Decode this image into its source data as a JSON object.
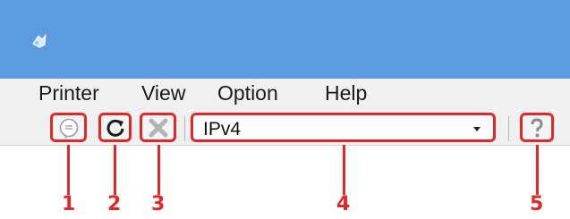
{
  "window": {
    "app_icon": "printer-app-icon",
    "title_color": "#5b9be0"
  },
  "menu": {
    "items": [
      {
        "label": "Printer"
      },
      {
        "label": "View"
      },
      {
        "label": "Option"
      },
      {
        "label": "Help"
      }
    ]
  },
  "toolbar": {
    "buttons": [
      {
        "icon": "message-bubble-icon"
      },
      {
        "icon": "refresh-icon"
      },
      {
        "icon": "cancel-x-icon"
      },
      {
        "icon": "help-question-icon"
      }
    ],
    "protocol_select": {
      "value": "IPv4"
    }
  },
  "callouts": [
    "1",
    "2",
    "3",
    "4",
    "5"
  ],
  "colors": {
    "highlight": "#e02828",
    "titlebar": "#5b9be0",
    "window_bg": "#f0f0f0"
  }
}
